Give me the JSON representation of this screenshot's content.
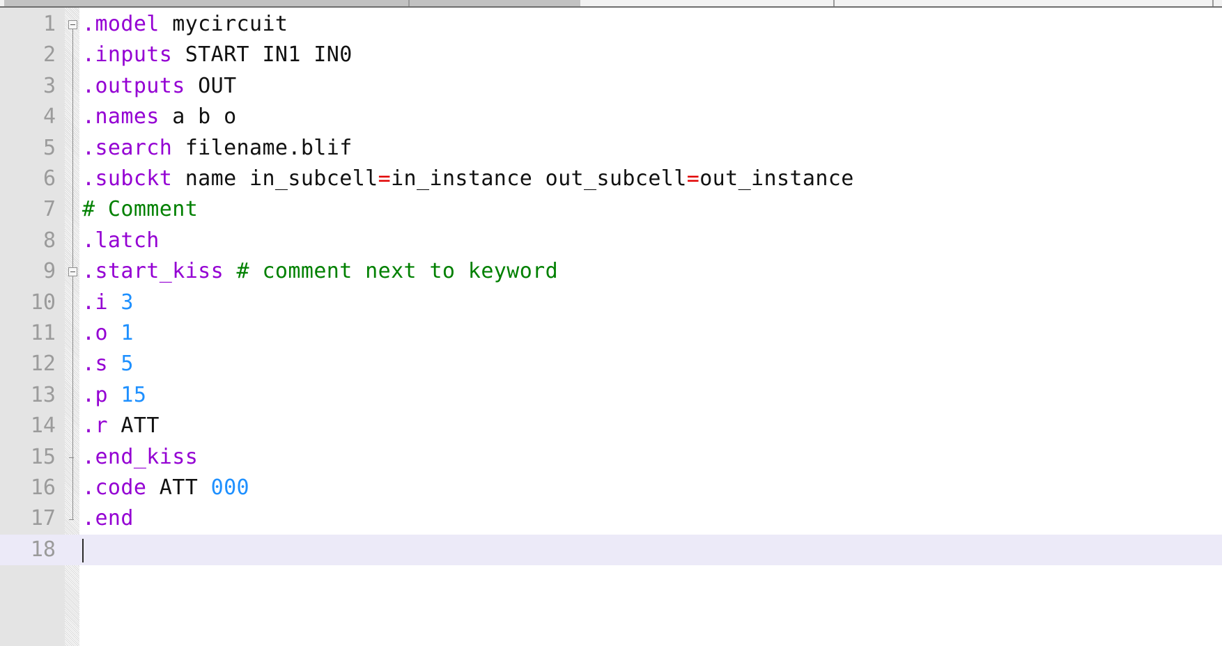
{
  "window": {
    "app": "text-editor",
    "top_chrome_segments": 3
  },
  "editor": {
    "language": "BLIF",
    "gutter": {
      "first_line": 1,
      "last_line": 18,
      "line_numbers": [
        "1",
        "2",
        "3",
        "4",
        "5",
        "6",
        "7",
        "8",
        "9",
        "10",
        "11",
        "12",
        "13",
        "14",
        "15",
        "16",
        "17",
        "18"
      ]
    },
    "current_line": 18,
    "caret": {
      "line": 18,
      "column": 1
    },
    "colors": {
      "background": "#ffffff",
      "gutter_background": "#e4e4e4",
      "line_number": "#9b9b9b",
      "current_line_highlight": "#eceaf8",
      "keyword": "#9400d3",
      "comment": "#008000",
      "number": "#1e90ff",
      "operator": "#e00000",
      "plain_text": "#111111",
      "fold_marker": "#8a8a8a"
    },
    "folds": [
      {
        "line": 1,
        "state": "expanded",
        "marker": "minus-box"
      },
      {
        "line": 9,
        "state": "expanded",
        "marker": "minus-box"
      }
    ],
    "lines": [
      {
        "n": 1,
        "fold": "open-outer",
        "tokens": [
          {
            "t": "kw",
            "v": ".model"
          },
          {
            "t": "pln",
            "v": " mycircuit"
          }
        ]
      },
      {
        "n": 2,
        "fold": "body-outer",
        "tokens": [
          {
            "t": "kw",
            "v": ".inputs"
          },
          {
            "t": "pln",
            "v": " START IN1 IN0"
          }
        ]
      },
      {
        "n": 3,
        "fold": "body-outer",
        "tokens": [
          {
            "t": "kw",
            "v": ".outputs"
          },
          {
            "t": "pln",
            "v": " OUT"
          }
        ]
      },
      {
        "n": 4,
        "fold": "body-outer",
        "tokens": [
          {
            "t": "kw",
            "v": ".names"
          },
          {
            "t": "pln",
            "v": " a b o"
          }
        ]
      },
      {
        "n": 5,
        "fold": "body-outer",
        "tokens": [
          {
            "t": "kw",
            "v": ".search"
          },
          {
            "t": "pln",
            "v": " filename.blif"
          }
        ]
      },
      {
        "n": 6,
        "fold": "body-outer",
        "tokens": [
          {
            "t": "kw",
            "v": ".subckt"
          },
          {
            "t": "pln",
            "v": " name in_subcell"
          },
          {
            "t": "op",
            "v": "="
          },
          {
            "t": "pln",
            "v": "in_instance out_subcell"
          },
          {
            "t": "op",
            "v": "="
          },
          {
            "t": "pln",
            "v": "out_instance"
          }
        ]
      },
      {
        "n": 7,
        "fold": "body-outer",
        "tokens": [
          {
            "t": "cmt",
            "v": "# Comment"
          }
        ]
      },
      {
        "n": 8,
        "fold": "body-outer",
        "tokens": [
          {
            "t": "kw",
            "v": ".latch"
          }
        ]
      },
      {
        "n": 9,
        "fold": "open-inner",
        "tokens": [
          {
            "t": "kw",
            "v": ".start_kiss"
          },
          {
            "t": "pln",
            "v": " "
          },
          {
            "t": "cmt",
            "v": "# comment next to keyword"
          }
        ]
      },
      {
        "n": 10,
        "fold": "body-inner",
        "tokens": [
          {
            "t": "kw",
            "v": ".i"
          },
          {
            "t": "pln",
            "v": " "
          },
          {
            "t": "num",
            "v": "3"
          }
        ]
      },
      {
        "n": 11,
        "fold": "body-inner",
        "tokens": [
          {
            "t": "kw",
            "v": ".o"
          },
          {
            "t": "pln",
            "v": " "
          },
          {
            "t": "num",
            "v": "1"
          }
        ]
      },
      {
        "n": 12,
        "fold": "body-inner",
        "tokens": [
          {
            "t": "kw",
            "v": ".s"
          },
          {
            "t": "pln",
            "v": " "
          },
          {
            "t": "num",
            "v": "5"
          }
        ]
      },
      {
        "n": 13,
        "fold": "body-inner",
        "tokens": [
          {
            "t": "kw",
            "v": ".p"
          },
          {
            "t": "pln",
            "v": " "
          },
          {
            "t": "num",
            "v": "15"
          }
        ]
      },
      {
        "n": 14,
        "fold": "body-inner",
        "tokens": [
          {
            "t": "kw",
            "v": ".r"
          },
          {
            "t": "pln",
            "v": " ATT"
          }
        ]
      },
      {
        "n": 15,
        "fold": "end-inner",
        "tokens": [
          {
            "t": "kw",
            "v": ".end_kiss"
          }
        ]
      },
      {
        "n": 16,
        "fold": "body-outer",
        "tokens": [
          {
            "t": "kw",
            "v": ".code"
          },
          {
            "t": "pln",
            "v": " ATT "
          },
          {
            "t": "num",
            "v": "000"
          }
        ]
      },
      {
        "n": 17,
        "fold": "end-outer",
        "tokens": [
          {
            "t": "kw",
            "v": ".end"
          }
        ]
      },
      {
        "n": 18,
        "fold": "none",
        "tokens": []
      }
    ]
  }
}
